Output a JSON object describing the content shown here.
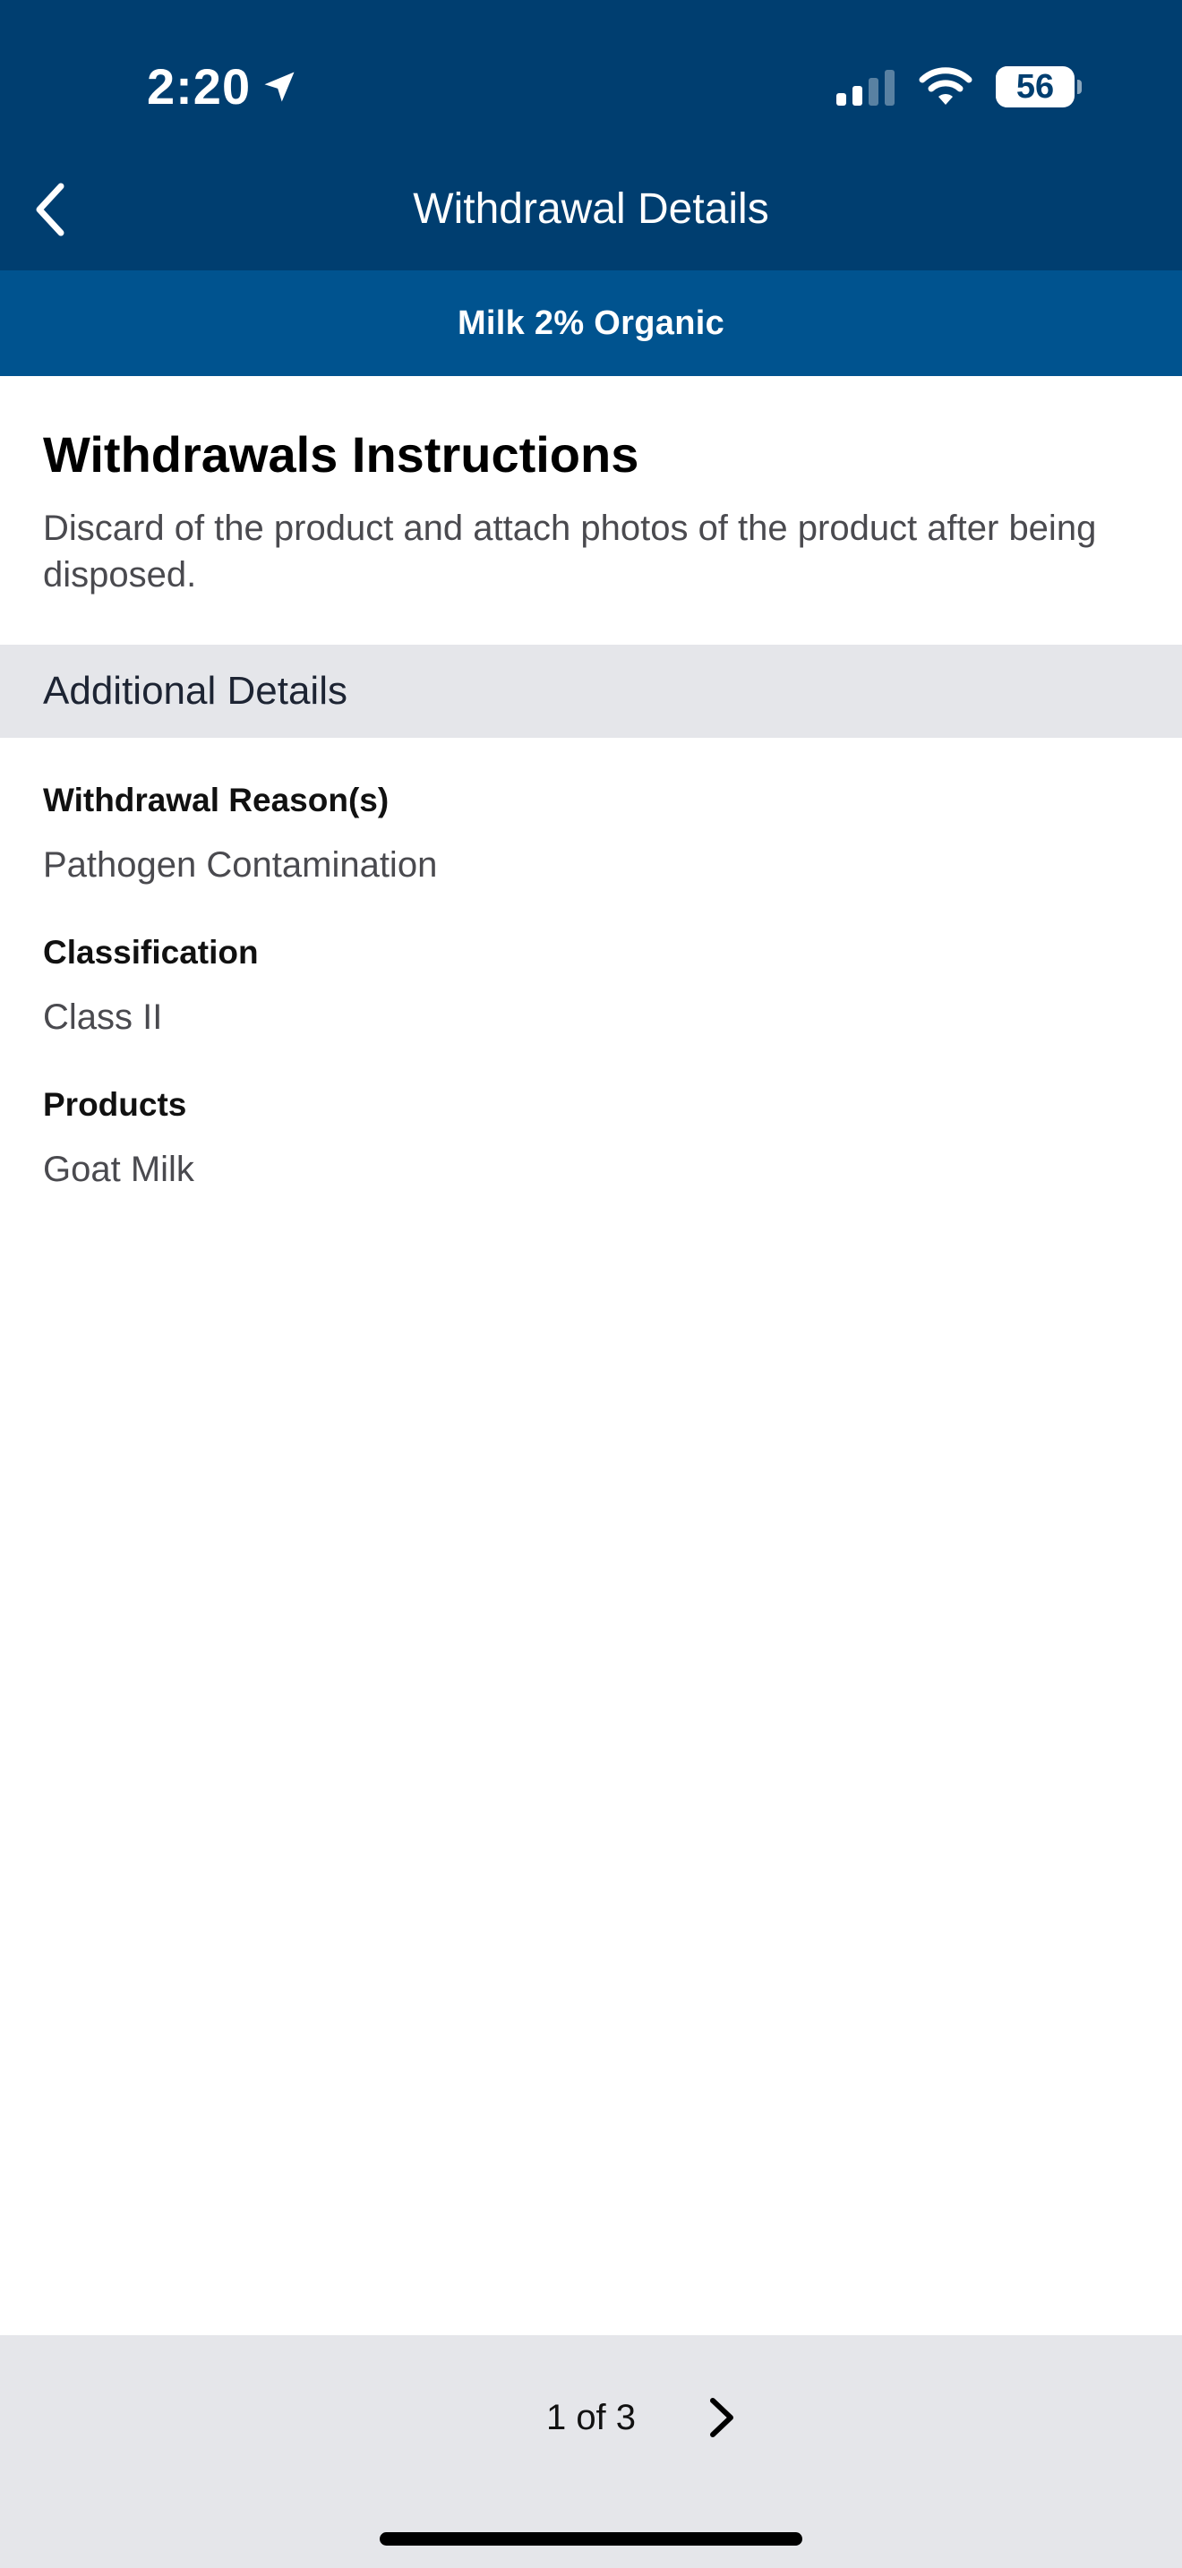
{
  "status_bar": {
    "time": "2:20",
    "battery_percent": "56",
    "battery_level": 0.56,
    "location_icon": "location-arrow-icon",
    "signal_icon": "cellular-signal-icon",
    "wifi_icon": "wifi-icon"
  },
  "nav": {
    "title": "Withdrawal Details",
    "back_icon": "chevron-left-icon"
  },
  "product_header": {
    "name": "Milk 2% Organic"
  },
  "instructions": {
    "title": "Withdrawals Instructions",
    "body": "Discard of the product and attach photos of the product after being disposed."
  },
  "additional_details": {
    "header": "Additional Details",
    "items": [
      {
        "label": "Withdrawal Reason(s)",
        "value": "Pathogen Contamination"
      },
      {
        "label": "Classification",
        "value": "Class II"
      },
      {
        "label": "Products",
        "value": "Goat Milk"
      }
    ]
  },
  "pager": {
    "text": "1 of 3",
    "next_icon": "chevron-right-icon"
  },
  "colors": {
    "nav_bg": "#003E70",
    "subheader_bg": "#00538F",
    "section_bg": "#E5E6EA",
    "body_text": "#4A4A4F"
  }
}
